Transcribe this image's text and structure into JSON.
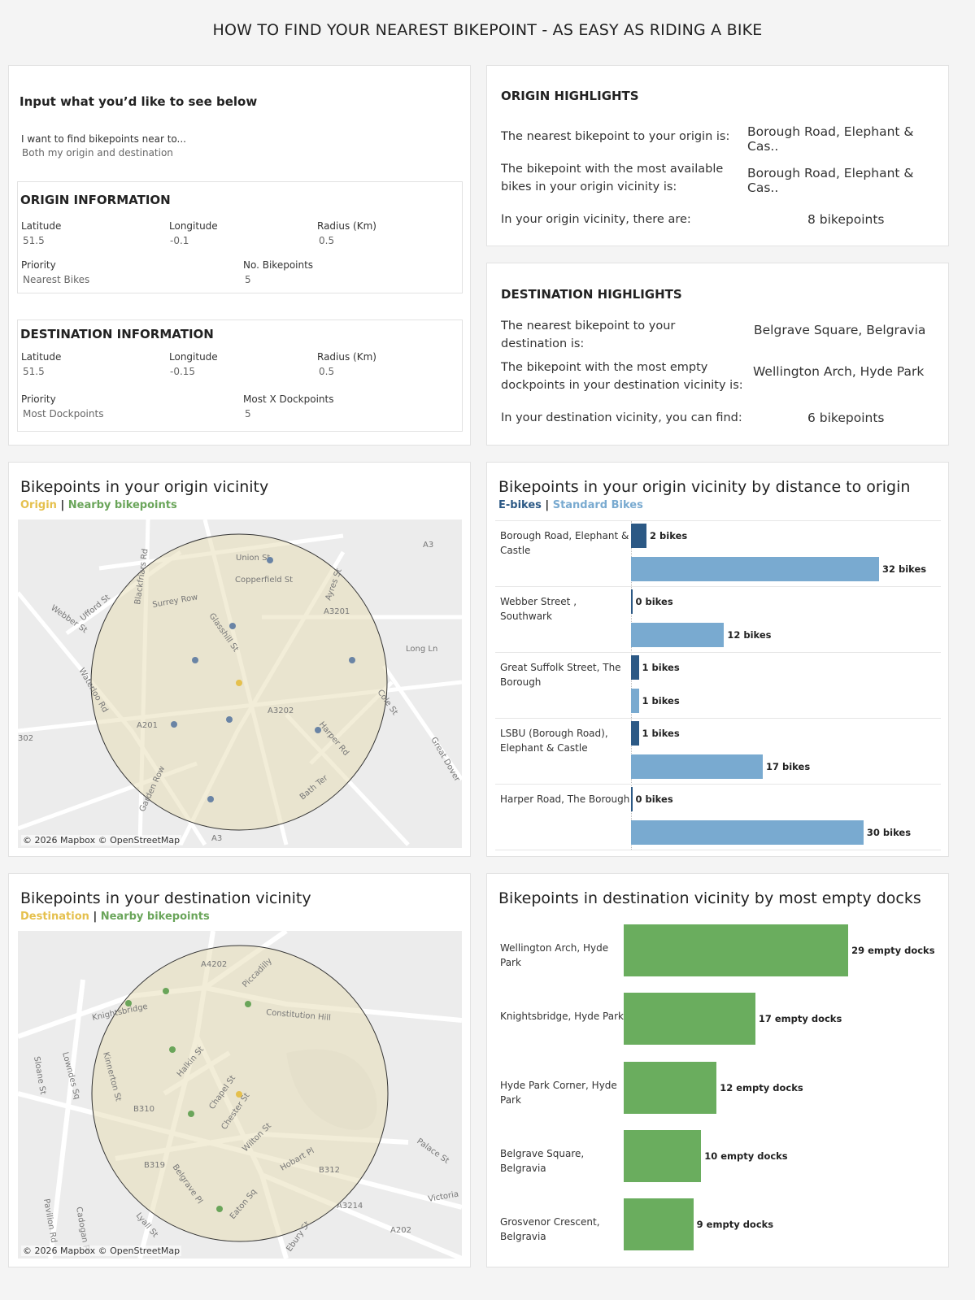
{
  "title": "HOW TO FIND YOUR NEAREST BIKEPOINT - AS EASY AS RIDING A BIKE",
  "input": {
    "heading": "Input what you’d like to see below",
    "find_label": "I want to find bikepoints near to...",
    "find_value": "Both my origin and destination"
  },
  "origin_info": {
    "heading": "ORIGIN INFORMATION",
    "latitude_label": "Latitude",
    "latitude": "51.5",
    "longitude_label": "Longitude",
    "longitude": "-0.1",
    "radius_label": "Radius (Km)",
    "radius": "0.5",
    "priority_label": "Priority",
    "priority": "Nearest Bikes",
    "count_label": "No. Bikepoints",
    "count": "5"
  },
  "destination_info": {
    "heading": "DESTINATION INFORMATION",
    "latitude_label": "Latitude",
    "latitude": "51.5",
    "longitude_label": "Longitude",
    "longitude": "-0.15",
    "radius_label": "Radius (Km)",
    "radius": "0.5",
    "priority_label": "Priority",
    "priority": "Most Dockpoints",
    "count_label": "Most X Dockpoints",
    "count": "5"
  },
  "origin_highlights": {
    "heading": "ORIGIN HIGHLIGHTS",
    "nearest_label": "The nearest bikepoint to your origin is:",
    "nearest": "Borough Road, Elephant & Cas..",
    "most_label": "The bikepoint with the most available bikes in your origin vicinity is:",
    "most": "Borough Road, Elephant & Cas..",
    "count_label": "In your origin vicinity, there are:",
    "count": "8 bikepoints"
  },
  "destination_highlights": {
    "heading": "DESTINATION HIGHLIGHTS",
    "nearest_label": "The nearest bikepoint to your destination is:",
    "nearest": "Belgrave Square, Belgravia",
    "most_label": "The bikepoint with the most empty dockpoints in your destination vicinity is:",
    "most": "Wellington Arch, Hyde Park",
    "count_label": "In your destination vicinity, you can find:",
    "count": "6 bikepoints"
  },
  "origin_map": {
    "title": "Bikepoints in your origin vicinity",
    "legend_a": "Origin",
    "legend_sep": "|",
    "legend_b": "Nearby bikepoints",
    "attribution": "© 2026 Mapbox © OpenStreetMap",
    "labels": [
      "Union St",
      "Copperfield St",
      "Surrey Row",
      "Blackfriars Rd",
      "Ufford St",
      "Webber St",
      "Glasshill St",
      "Ayres St",
      "A3201",
      "Long Ln",
      "Waterloo Rd",
      "A201",
      "A3202",
      "Cole St",
      "Harper Rd",
      "Bath Ter",
      "Garden Row",
      "Great Dover",
      "A3",
      "302"
    ]
  },
  "destination_map": {
    "title": "Bikepoints in your destination vicinity",
    "legend_a": "Destination",
    "legend_sep": "|",
    "legend_b": "Nearby bikepoints",
    "attribution": "© 2026 Mapbox © OpenStreetMap",
    "labels": [
      "A4202",
      "Piccadilly",
      "Knightsbridge",
      "Constitution Hill",
      "Halkin St",
      "Kinnerton St",
      "Lowndes Sq",
      "Sloane St",
      "Chapel St",
      "Chester St",
      "B310",
      "Wilton St",
      "Hobart Pl",
      "B319",
      "Belgrave Pl",
      "B312",
      "Palace St",
      "Cadogan Pl",
      "Eaton Sq",
      "A3214",
      "Victoria",
      "Lyall St",
      "Ebury St",
      "A202",
      "Pavilion Rd"
    ]
  },
  "colors": {
    "ebike": "#2c5985",
    "standard": "#79aad0",
    "origin": "#e5c04d",
    "nearby_origin": "#6a84a5",
    "nearby_dest": "#6aa55a",
    "docks": "#6aad5e"
  },
  "chart_data": [
    {
      "type": "bar",
      "title": "Bikepoints in your origin vicinity by distance to origin",
      "legend": [
        "E-bikes",
        "Standard Bikes"
      ],
      "categories": [
        "Borough Road, Elephant & Castle",
        "Webber Street , Southwark",
        "Great Suffolk Street, The Borough",
        "LSBU (Borough Road), Elephant & Castle",
        "Harper Road, The Borough"
      ],
      "series": [
        {
          "name": "E-bikes",
          "values": [
            2,
            0,
            1,
            1,
            0
          ]
        },
        {
          "name": "Standard Bikes",
          "values": [
            32,
            12,
            1,
            17,
            30
          ]
        }
      ],
      "unit": "bikes"
    },
    {
      "type": "bar",
      "title": "Bikepoints in destination vicinity by most empty docks",
      "categories": [
        "Wellington Arch, Hyde Park",
        "Knightsbridge, Hyde Park",
        "Hyde Park Corner, Hyde Park",
        "Belgrave Square, Belgravia",
        "Grosvenor Crescent, Belgravia"
      ],
      "values": [
        29,
        17,
        12,
        10,
        9
      ],
      "unit": "empty docks"
    }
  ]
}
